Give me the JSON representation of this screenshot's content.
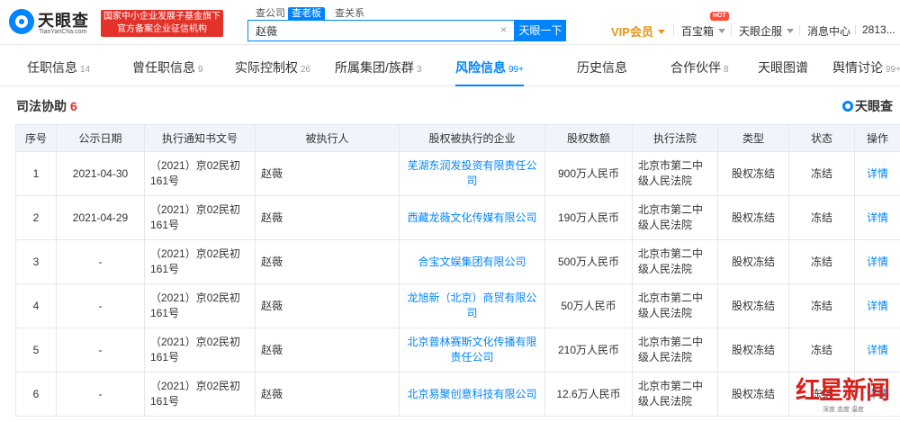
{
  "header": {
    "logo_cn": "天眼查",
    "logo_en": "TianYanCha.com",
    "badge_line1": "国家中小企业发展子基金旗下",
    "badge_line2": "官方备案企业征信机构",
    "search_tabs": [
      "查公司",
      "查老板",
      "查关系"
    ],
    "search_value": "赵薇",
    "search_button": "天眼一下",
    "vip": "VIP会员",
    "treasure": "百宝箱",
    "hot": "HOT",
    "enterprise": "天眼企服",
    "messages": "消息中心",
    "user": "2813..."
  },
  "tabs": [
    {
      "label": "任职信息",
      "count": "14"
    },
    {
      "label": "曾任职信息",
      "count": "9"
    },
    {
      "label": "实际控制权",
      "count": "26"
    },
    {
      "label": "所属集团/族群",
      "count": "3"
    },
    {
      "label": "风险信息",
      "count": "99+"
    },
    {
      "label": "历史信息",
      "count": ""
    },
    {
      "label": "合作伙伴",
      "count": "8"
    },
    {
      "label": "天眼图谱",
      "count": ""
    },
    {
      "label": "舆情讨论",
      "count": "99+"
    }
  ],
  "section": {
    "title": "司法协助",
    "count": "6",
    "brand": "天眼查"
  },
  "table": {
    "headers": [
      "序号",
      "公示日期",
      "执行通知书文号",
      "被执行人",
      "股权被执行的企业",
      "股权数额",
      "执行法院",
      "类型",
      "状态",
      "操作"
    ],
    "rows": [
      {
        "no": "1",
        "date": "2021-04-30",
        "doc": "（2021）京02民初161号",
        "person": "赵薇",
        "company": "芜湖东润发投资有限责任公司",
        "amount": "900万人民币",
        "court": "北京市第二中级人民法院",
        "type": "股权冻结",
        "status": "冻结",
        "action": "详情"
      },
      {
        "no": "2",
        "date": "2021-04-29",
        "doc": "（2021）京02民初161号",
        "person": "赵薇",
        "company": "西藏龙薇文化传媒有限公司",
        "amount": "190万人民币",
        "court": "北京市第二中级人民法院",
        "type": "股权冻结",
        "status": "冻结",
        "action": "详情"
      },
      {
        "no": "3",
        "date": "-",
        "doc": "（2021）京02民初161号",
        "person": "赵薇",
        "company": "合宝文娱集团有限公司",
        "amount": "500万人民币",
        "court": "北京市第二中级人民法院",
        "type": "股权冻结",
        "status": "冻结",
        "action": "详情"
      },
      {
        "no": "4",
        "date": "-",
        "doc": "（2021）京02民初161号",
        "person": "赵薇",
        "company": "龙旭新（北京）商贸有限公司",
        "amount": "50万人民币",
        "court": "北京市第二中级人民法院",
        "type": "股权冻结",
        "status": "冻结",
        "action": "详情"
      },
      {
        "no": "5",
        "date": "-",
        "doc": "（2021）京02民初161号",
        "person": "赵薇",
        "company": "北京普林赛斯文化传播有限责任公司",
        "amount": "210万人民币",
        "court": "北京市第二中级人民法院",
        "type": "股权冻结",
        "status": "冻结",
        "action": "详情"
      },
      {
        "no": "6",
        "date": "-",
        "doc": "（2021）京02民初161号",
        "person": "赵薇",
        "company": "北京易聚创意科技有限公司",
        "amount": "12.6万人民币",
        "court": "北京市第二中级人民法院",
        "type": "股权冻结",
        "status": "冻结",
        "action": "详情"
      }
    ]
  },
  "watermark": {
    "text": "红星新闻",
    "sub": "深度 态度 温度"
  }
}
